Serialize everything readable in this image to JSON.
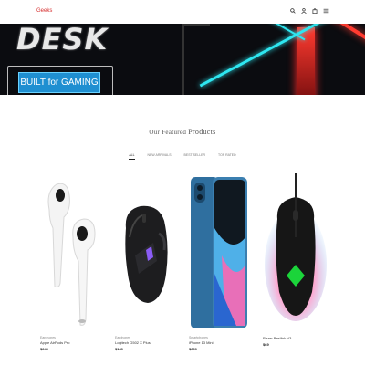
{
  "header": {
    "logo": "Geeks",
    "icons": [
      "search-icon",
      "user-icon",
      "cart-icon",
      "menu-icon"
    ]
  },
  "hero": {
    "title": "DESK",
    "button_label": "BUILT for GAMING"
  },
  "featured": {
    "title_small": "Our Featured",
    "title_big": "Products",
    "tabs": [
      "All",
      "New Arrivals",
      "Best Seller",
      "Top Rated"
    ],
    "active_tab": "All"
  },
  "products": [
    {
      "category": "Earphones",
      "name": "Apple AirPods Pro",
      "price": "$249"
    },
    {
      "category": "Earphones",
      "name": "Logitech G502 X Plus",
      "price": "$149"
    },
    {
      "category": "Smartphones",
      "name": "iPhone 13 Mini",
      "price": "$699"
    },
    {
      "category": "",
      "name": "Razer Basilisk V3",
      "price": "$69"
    }
  ],
  "colors": {
    "logo": "#d62c2c",
    "hero_button": "#1f8fd1",
    "neon_red": "#ff3b30",
    "neon_cyan": "#2ee6f0"
  }
}
